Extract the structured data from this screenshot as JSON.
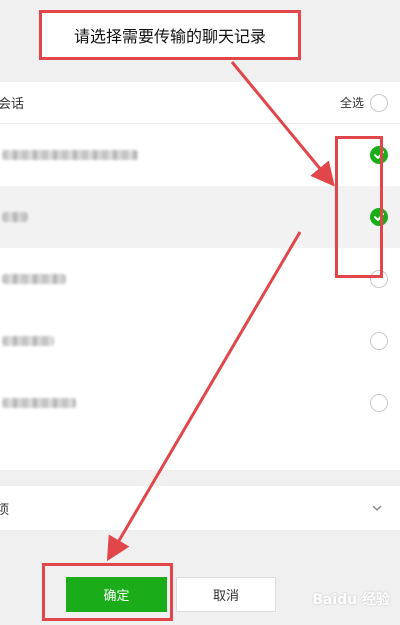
{
  "banner": {
    "text": "请选择需要传输的聊天记录"
  },
  "panel": {
    "header_label": "会话",
    "select_all_label": "全选"
  },
  "conversations": [
    {
      "checked": true
    },
    {
      "checked": true
    },
    {
      "checked": false
    },
    {
      "checked": false
    },
    {
      "checked": false
    }
  ],
  "type_bar": {
    "label": "项"
  },
  "buttons": {
    "confirm_label": "确定",
    "cancel_label": "取消"
  },
  "watermark": {
    "text": "Baidu 经验"
  },
  "colors": {
    "accent_green": "#1aad19",
    "annotation_red": "#e0464a"
  }
}
